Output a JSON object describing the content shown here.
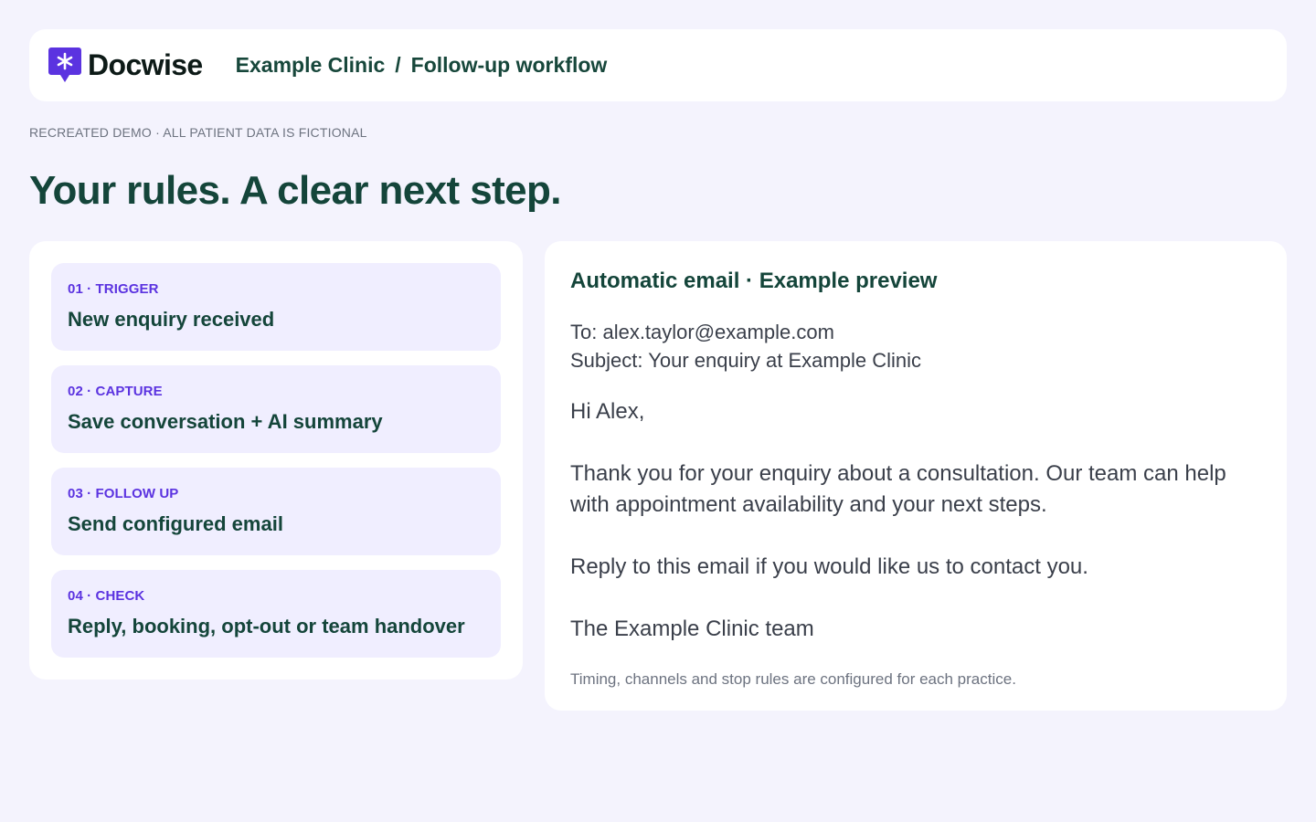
{
  "brand": {
    "name": "Docwise",
    "accent": "#5b33e0",
    "icon": "chat-asterisk-icon"
  },
  "breadcrumb": {
    "clinic": "Example Clinic",
    "separator": "/",
    "page": "Follow-up workflow"
  },
  "disclaimer": "RECREATED DEMO · ALL PATIENT DATA IS FICTIONAL",
  "headline": "Your rules. A clear next step.",
  "steps": [
    {
      "tag": "01 · TRIGGER",
      "title": "New enquiry received"
    },
    {
      "tag": "02 · CAPTURE",
      "title": "Save conversation + AI summary"
    },
    {
      "tag": "03 · FOLLOW UP",
      "title": "Send configured email"
    },
    {
      "tag": "04 · CHECK",
      "title": "Reply, booking, opt-out or team handover"
    }
  ],
  "email": {
    "heading": "Automatic email · Example preview",
    "to": "To: alex.taylor@example.com",
    "subject": "Subject: Your enquiry at Example Clinic",
    "greeting": "Hi Alex,",
    "paragraph1": "Thank you for your enquiry about a consultation. Our team can help with appointment availability and your next steps.",
    "paragraph2": "Reply to this email if you would like us to contact you.",
    "signoff": "The Example Clinic team",
    "footnote": "Timing, channels and stop rules are configured for each practice."
  },
  "colors": {
    "background": "#f4f3fd",
    "card": "#ffffff",
    "step_bg": "#f0eeff",
    "heading": "#14453a",
    "tag": "#5b33e0"
  }
}
